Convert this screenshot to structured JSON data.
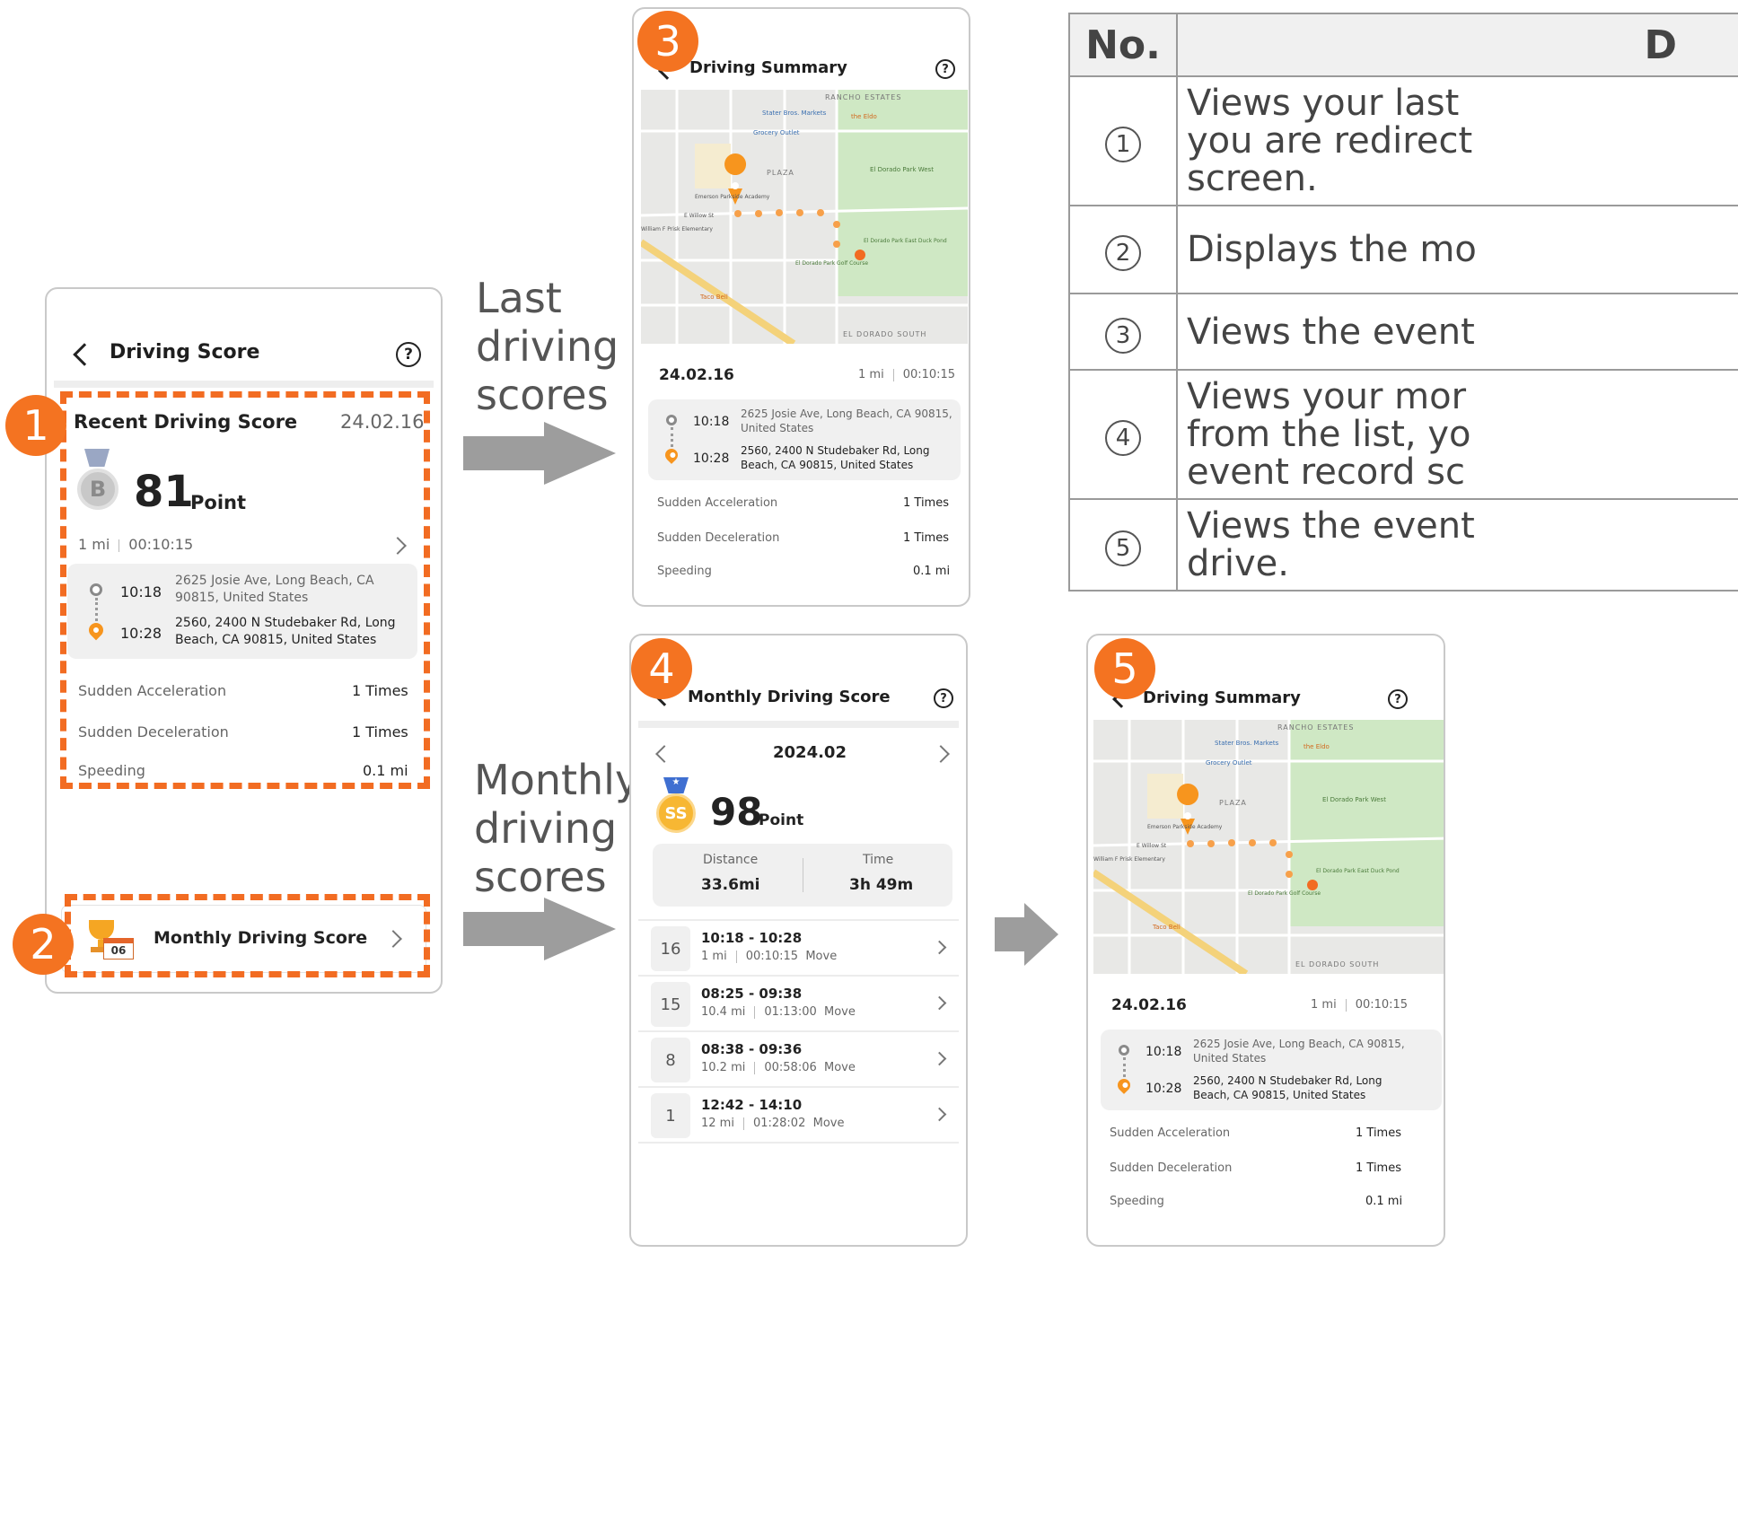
{
  "flow_labels": {
    "last": [
      "Last",
      "driving",
      "scores"
    ],
    "monthly": [
      "Monthly",
      "driving",
      "scores"
    ]
  },
  "callouts": [
    "1",
    "2",
    "3",
    "4",
    "5"
  ],
  "screen1": {
    "title": "Driving Score",
    "help": "?",
    "recent": {
      "heading": "Recent Driving Score",
      "date": "24.02.16",
      "grade": "B",
      "score": "81",
      "unit": "Point",
      "distance": "1 mi",
      "duration": "00:10:15",
      "start_time": "10:18",
      "start_addr_1": "2625 Josie Ave, Long Beach,  CA",
      "start_addr_2": "90815, United States",
      "end_time": "10:28",
      "end_addr_1": "2560, 2400 N Studebaker Rd, Long",
      "end_addr_2": "Beach, CA 90815, United States"
    },
    "stats": [
      {
        "label": "Sudden Acceleration",
        "value": "1 Times"
      },
      {
        "label": "Sudden Deceleration",
        "value": "1 Times"
      },
      {
        "label": "Speeding",
        "value": "0.1 mi"
      }
    ],
    "monthly_button": "Monthly Driving Score",
    "calendar_day": "06"
  },
  "summary": {
    "title": "Driving Summary",
    "help": "?",
    "map_labels": {
      "rancho": "RANCHO ESTATES",
      "plaza": "PLAZA",
      "eldorado_south": "EL DORADO SOUTH",
      "stater": "Stater Bros. Markets",
      "grocery": "Grocery Outlet",
      "eldo": "the Eldo",
      "park_west": "El Dorado Park West",
      "duck_pond": "El Dorado Park East Duck Pond",
      "golf": "El Dorado Park Golf Course",
      "taco": "Taco Bell",
      "academy": "Emerson Parkside Academy",
      "willow": "E Willow St",
      "prisk": "William F Prisk Elementary"
    },
    "date": "24.02.16",
    "distance": "1 mi",
    "duration": "00:10:15",
    "start_time": "10:18",
    "start_addr_1": "2625 Josie Ave, Long Beach,  CA 90815,",
    "start_addr_2": "United States",
    "end_time": "10:28",
    "end_addr_1": "2560, 2400 N Studebaker Rd, Long",
    "end_addr_2": "Beach, CA 90815, United States",
    "stats": [
      {
        "label": "Sudden Acceleration",
        "value": "1 Times"
      },
      {
        "label": "Sudden Deceleration",
        "value": "1 Times"
      },
      {
        "label": "Speeding",
        "value": "0.1 mi"
      }
    ]
  },
  "monthly": {
    "title": "Monthly Driving Score",
    "help": "?",
    "month": "2024.02",
    "grade": "SS",
    "score": "98",
    "unit": "Point",
    "distance_label": "Distance",
    "distance_value": "33.6mi",
    "time_label": "Time",
    "time_value": "3h 49m",
    "trips": [
      {
        "day": "16",
        "range": "10:18 - 10:28",
        "dist": "1 mi",
        "dur": "00:10:15",
        "type": "Move"
      },
      {
        "day": "15",
        "range": "08:25 - 09:38",
        "dist": "10.4 mi",
        "dur": "01:13:00",
        "type": "Move"
      },
      {
        "day": "8",
        "range": "08:38 - 09:36",
        "dist": "10.2 mi",
        "dur": "00:58:06",
        "type": "Move"
      },
      {
        "day": "1",
        "range": "12:42 - 14:10",
        "dist": "12 mi",
        "dur": "01:28:02",
        "type": "Move"
      }
    ]
  },
  "table": {
    "header_no": "No.",
    "header_desc": "D",
    "rows": [
      {
        "no": "1",
        "lines": [
          "Views your last",
          "you are redirect",
          "screen."
        ]
      },
      {
        "no": "2",
        "lines": [
          "Displays the mo"
        ]
      },
      {
        "no": "3",
        "lines": [
          "Views the event"
        ]
      },
      {
        "no": "4",
        "lines": [
          "Views your mor",
          "from the list, yo",
          "event record sc"
        ]
      },
      {
        "no": "5",
        "lines": [
          "Views the event",
          "drive."
        ]
      }
    ]
  },
  "colors": {
    "accent": "#f47321",
    "arrow": "#9d9d9d",
    "park": "#cfe8c4"
  }
}
